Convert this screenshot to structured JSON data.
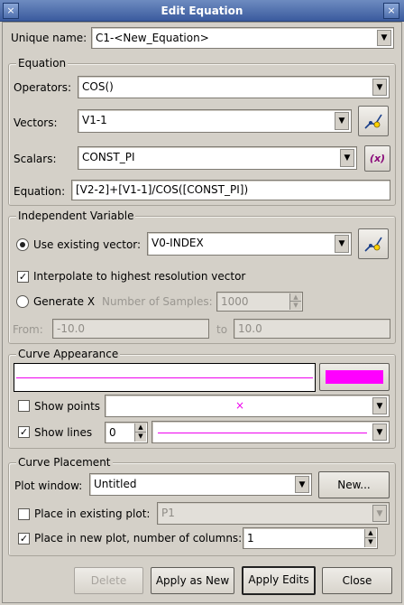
{
  "window": {
    "title": "Edit Equation"
  },
  "unique_name": {
    "label": "Unique name:",
    "value": "C1-<New_Equation>"
  },
  "equation_group": {
    "title": "Equation",
    "operators": {
      "label": "Operators:",
      "value": "COS()"
    },
    "vectors": {
      "label": "Vectors:",
      "value": "V1-1"
    },
    "scalars": {
      "label": "Scalars:",
      "value": "CONST_PI"
    },
    "equation": {
      "label": "Equation:",
      "value": "[V2-2]+[V1-1]/COS([CONST_PI])"
    },
    "scalar_icon_text": "(x)"
  },
  "independent_variable": {
    "title": "Independent Variable",
    "use_existing": {
      "label": "Use existing vector:",
      "value": "V0-INDEX"
    },
    "interpolate": {
      "label": "Interpolate to highest resolution vector"
    },
    "generate": {
      "label": "Generate X",
      "samples_label": "Number of Samples:",
      "samples_value": "1000",
      "from_label": "From:",
      "from_value": "-10.0",
      "to_label": "to",
      "to_value": "10.0"
    }
  },
  "curve_appearance": {
    "title": "Curve Appearance",
    "show_points": {
      "label": "Show points",
      "marker": "×"
    },
    "show_lines": {
      "label": "Show lines",
      "width": "0"
    },
    "colors": {
      "line": "#ee00ee",
      "swatch": "#ff00ff"
    }
  },
  "curve_placement": {
    "title": "Curve Placement",
    "plot_window": {
      "label": "Plot window:",
      "value": "Untitled",
      "new_button": "New..."
    },
    "existing_plot": {
      "label": "Place in existing plot:",
      "value": "P1"
    },
    "new_plot": {
      "label": "Place in new plot, number of columns:",
      "value": "1"
    }
  },
  "buttons": {
    "delete": "Delete",
    "apply_as_new": "Apply as New",
    "apply_edits": "Apply Edits",
    "close": "Close"
  }
}
